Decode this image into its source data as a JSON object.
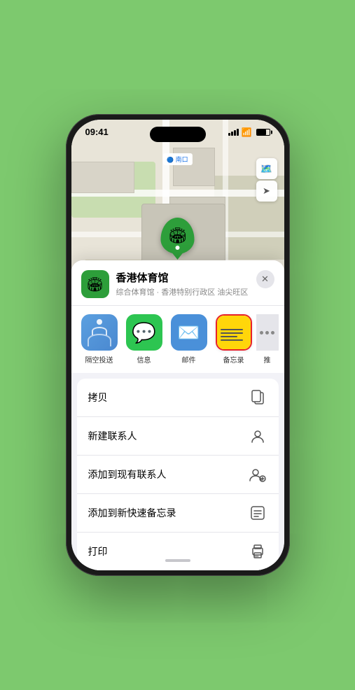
{
  "status_bar": {
    "time": "09:41",
    "location_arrow": "▶"
  },
  "map": {
    "label": "南口",
    "venue_name": "香港体育馆",
    "controls": {
      "map_icon": "🗺",
      "location_icon": "⬆"
    }
  },
  "bottom_sheet": {
    "venue_icon": "🏟",
    "venue_title": "香港体育馆",
    "venue_subtitle": "综合体育馆 · 香港特别行政区 油尖旺区",
    "close_label": "✕"
  },
  "share_icons": [
    {
      "id": "airdrop",
      "label": "隔空投送",
      "type": "airdrop"
    },
    {
      "id": "messages",
      "label": "信息",
      "type": "messages"
    },
    {
      "id": "mail",
      "label": "邮件",
      "type": "mail"
    },
    {
      "id": "notes",
      "label": "备忘录",
      "type": "notes"
    },
    {
      "id": "more",
      "label": "推",
      "type": "more"
    }
  ],
  "action_items": [
    {
      "id": "copy",
      "label": "拷贝",
      "icon": "copy"
    },
    {
      "id": "new-contact",
      "label": "新建联系人",
      "icon": "person"
    },
    {
      "id": "add-existing",
      "label": "添加到现有联系人",
      "icon": "person-add"
    },
    {
      "id": "add-notes",
      "label": "添加到新快速备忘录",
      "icon": "notes"
    },
    {
      "id": "print",
      "label": "打印",
      "icon": "print"
    }
  ],
  "colors": {
    "green_accent": "#2d9e3a",
    "notes_selected_border": "#e8222a",
    "background": "#7dc96e"
  }
}
